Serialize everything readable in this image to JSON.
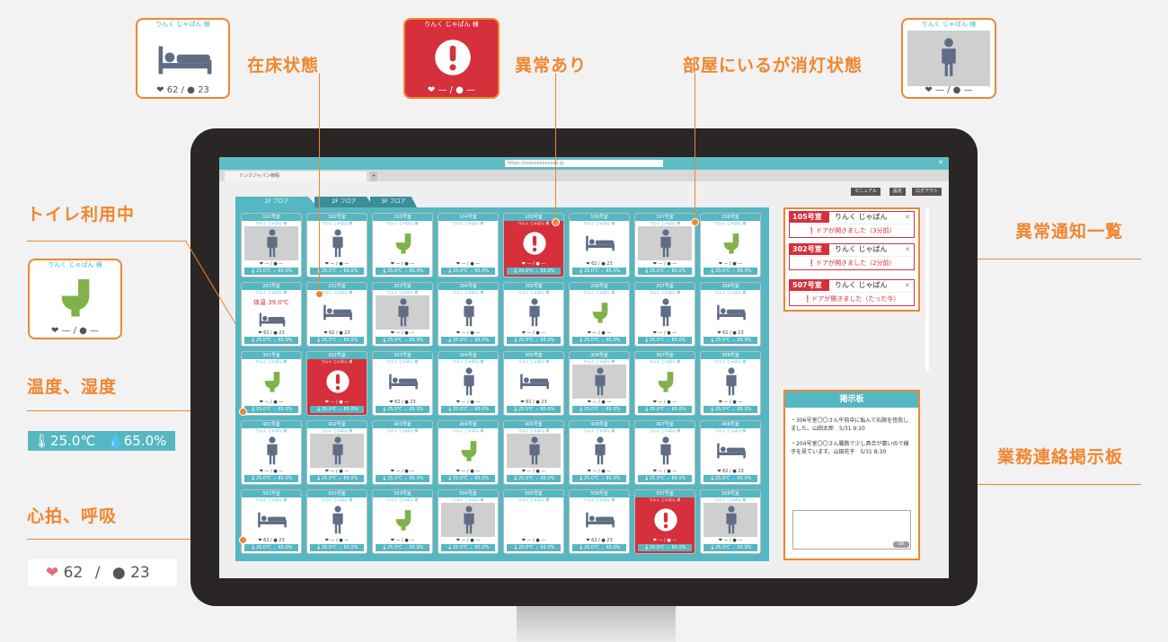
{
  "callouts": {
    "bed": "在床状態",
    "alert": "異常あり",
    "lightoff": "部屋にいるが消灯状態",
    "toilet": "トイレ利用中",
    "env": "温度、湿度",
    "vital": "心拍、呼吸",
    "notify": "異常通知一覧",
    "board": "業務連絡掲示板"
  },
  "examples": {
    "name": "りんく じゃぱん 様",
    "bed_vitals": "❤ 62 / ● 23",
    "empty_vitals": "❤ — / ● —",
    "toilet_vitals": "❤ — / ● —",
    "env_temp": "25.0℃",
    "env_hum": "65.0%",
    "vital_heart": "62",
    "vital_sep": "/",
    "vital_resp": "23"
  },
  "browser": {
    "url": "https://xxxxxxxxxxxxx.jp",
    "tab": "リンクジャパン御殿",
    "new_tab": "+"
  },
  "toolbar": {
    "manual": "マニュアル",
    "settings": "設定",
    "logout": "ログアウト"
  },
  "floors": [
    "1F フロア",
    "2F フロア",
    "3F フロア"
  ],
  "room_name": "りんく じゃぱん 様",
  "room_env": "🌡25.0℃ 💧65.0%",
  "vitals_on": "❤ 62 / ● 23",
  "vitals_off": "❤ — / ● —",
  "temp_warning": "体温 39.0℃",
  "rows": [
    [
      {
        "n": "101号室",
        "s": "grey"
      },
      {
        "n": "102号室",
        "s": "person"
      },
      {
        "n": "103号室",
        "s": "toilet"
      },
      {
        "n": "104号室",
        "s": "empty"
      },
      {
        "n": "105号室",
        "s": "alert"
      },
      {
        "n": "106号室",
        "s": "bed"
      },
      {
        "n": "107号室",
        "s": "grey"
      },
      {
        "n": "108号室",
        "s": "toilet"
      }
    ],
    [
      {
        "n": "201号室",
        "s": "temp"
      },
      {
        "n": "202号室",
        "s": "bed"
      },
      {
        "n": "203号室",
        "s": "grey"
      },
      {
        "n": "204号室",
        "s": "person"
      },
      {
        "n": "205号室",
        "s": "person"
      },
      {
        "n": "206号室",
        "s": "toilet"
      },
      {
        "n": "207号室",
        "s": "person"
      },
      {
        "n": "208号室",
        "s": "bed"
      }
    ],
    [
      {
        "n": "301号室",
        "s": "toilet"
      },
      {
        "n": "302号室",
        "s": "alert"
      },
      {
        "n": "303号室",
        "s": "bed"
      },
      {
        "n": "304号室",
        "s": "person"
      },
      {
        "n": "305号室",
        "s": "bed"
      },
      {
        "n": "306号室",
        "s": "grey"
      },
      {
        "n": "307号室",
        "s": "toilet"
      },
      {
        "n": "308号室",
        "s": "person"
      }
    ],
    [
      {
        "n": "401号室",
        "s": "person"
      },
      {
        "n": "402号室",
        "s": "grey"
      },
      {
        "n": "403号室",
        "s": "empty"
      },
      {
        "n": "404号室",
        "s": "toilet"
      },
      {
        "n": "405号室",
        "s": "grey"
      },
      {
        "n": "406号室",
        "s": "person"
      },
      {
        "n": "407号室",
        "s": "person"
      },
      {
        "n": "408号室",
        "s": "bed"
      }
    ],
    [
      {
        "n": "501号室",
        "s": "bed"
      },
      {
        "n": "502号室",
        "s": "person"
      },
      {
        "n": "503号室",
        "s": "toilet"
      },
      {
        "n": "504号室",
        "s": "grey"
      },
      {
        "n": "505号室",
        "s": "empty"
      },
      {
        "n": "506号室",
        "s": "bed"
      },
      {
        "n": "507号室",
        "s": "alert"
      },
      {
        "n": "508号室",
        "s": "grey"
      }
    ]
  ],
  "notifications": [
    {
      "room": "105号室",
      "name": "りんく じゃぱん",
      "msg": "ドアが開きました（3分前）"
    },
    {
      "room": "302号室",
      "name": "りんく じゃぱん",
      "msg": "ドアが開きました（2分前）"
    },
    {
      "room": "507号室",
      "name": "りんく じゃぱん",
      "msg": "ドアが開きました（たった今）"
    }
  ],
  "board": {
    "title": "掲示板",
    "msg1": "・306号室〇〇さん午前中に転んで右腕を怪我しました。山田太郎　5/31 9:10",
    "msg2": "・204号室〇〇さん腸筋で少し具合が悪いので様子を見ています。山田花子　5/31 8:30",
    "ok": "OK"
  },
  "colors": {
    "accent": "#f0862e",
    "teal": "#55b7c1",
    "alert": "#d5303b",
    "icon": "#5f6d85",
    "toilet": "#7fb24a"
  }
}
